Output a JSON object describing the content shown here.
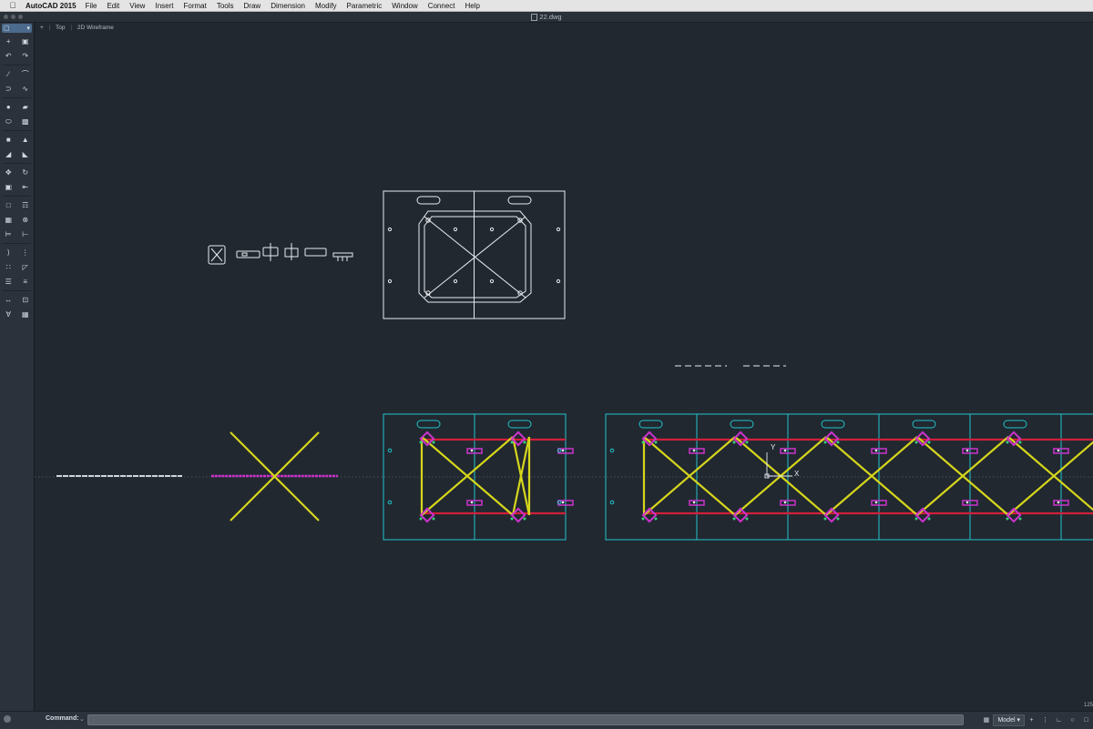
{
  "menubar": {
    "apple": "",
    "app_name": "AutoCAD 2015",
    "items": [
      "File",
      "Edit",
      "View",
      "Insert",
      "Format",
      "Tools",
      "Draw",
      "Dimension",
      "Modify",
      "Parametric",
      "Window",
      "Connect",
      "Help"
    ]
  },
  "window": {
    "document_title": "22.dwg"
  },
  "viewport": {
    "control": "+",
    "view": "Top",
    "visual_style": "2D Wireframe"
  },
  "toolbar": {
    "icons": [
      "select-icon",
      "point-icon",
      "block-icon",
      "undo-icon",
      "redo-icon",
      "line-icon",
      "arc-icon",
      "polyline-icon",
      "spline-icon",
      "circle-icon",
      "rectangle-icon",
      "ellipse-icon",
      "hatch-icon",
      "extrude-icon",
      "presspull-icon",
      "fillet-icon",
      "chamfer-icon",
      "move-icon",
      "rotate-icon",
      "scale-icon",
      "stretch-icon",
      "copy-icon",
      "mirror-icon",
      "array-icon",
      "offset-icon",
      "trim-icon",
      "extend-icon",
      "break-icon",
      "join-icon",
      "explode-icon",
      "layer-icon",
      "properties-icon",
      "dimension-icon",
      "text-icon",
      "measure-icon",
      "table-icon"
    ]
  },
  "canvas": {
    "ucs": {
      "y_label": "Y",
      "x_label": "X"
    },
    "colors": {
      "background": "#212830",
      "white": "#e8ecf0",
      "cyan": "#22c4cc",
      "yellow": "#d6d61c",
      "red": "#d0203a",
      "magenta": "#cc33cc",
      "green": "#36d07a",
      "grey_axis": "#55606c"
    }
  },
  "command": {
    "label": "Command:",
    "value": ""
  },
  "status_bar": {
    "layout": "Model",
    "coordinate": "125"
  }
}
